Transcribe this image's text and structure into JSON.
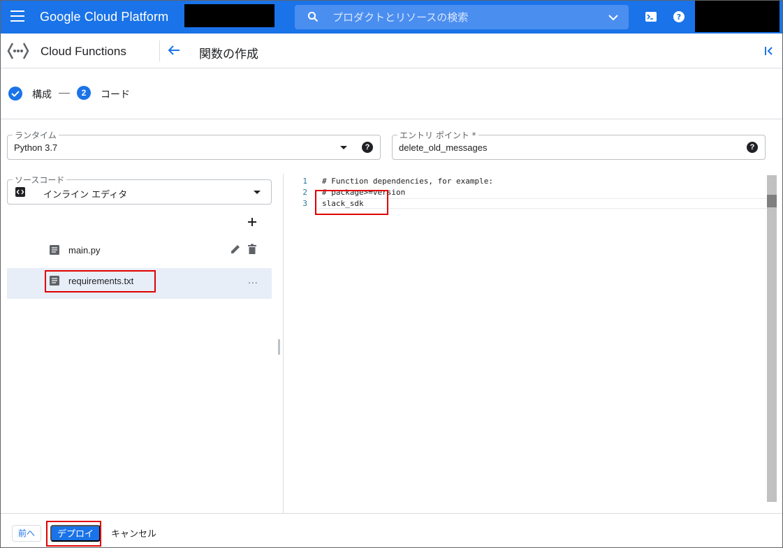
{
  "header": {
    "brand": "Google Cloud Platform",
    "search_placeholder": "プロダクトとリソースの検索",
    "accent_color": "#1a73e8"
  },
  "product": {
    "name": "Cloud Functions",
    "page_title": "関数の作成"
  },
  "stepper": {
    "step1_label": "構成",
    "step2_number": "2",
    "step2_label": "コード"
  },
  "runtime": {
    "label": "ランタイム",
    "value": "Python 3.7"
  },
  "entry_point": {
    "label": "エントリ ポイント *",
    "value": "delete_old_messages"
  },
  "source": {
    "label": "ソースコード",
    "value": "インライン エディタ"
  },
  "files": [
    {
      "name": "main.py",
      "selected": false
    },
    {
      "name": "requirements.txt",
      "selected": true
    }
  ],
  "more_label": "...",
  "editor": {
    "lines": [
      {
        "num": "1",
        "text": "# Function dependencies, for example:"
      },
      {
        "num": "2",
        "text": "# package>=version"
      },
      {
        "num": "3",
        "text": "slack_sdk"
      }
    ]
  },
  "footer": {
    "prev_label": "前へ",
    "deploy_label": "デプロイ",
    "cancel_label": "キャンセル"
  },
  "icons": {
    "menu": "hamburger-menu-icon",
    "search": "search-icon",
    "cloud_shell": "cloud-shell-icon",
    "help": "help-icon",
    "back": "arrow-back-icon",
    "collapse": "collapse-panel-icon",
    "add": "plus-icon",
    "edit": "pencil-icon",
    "delete": "trash-icon",
    "file": "file-icon"
  }
}
